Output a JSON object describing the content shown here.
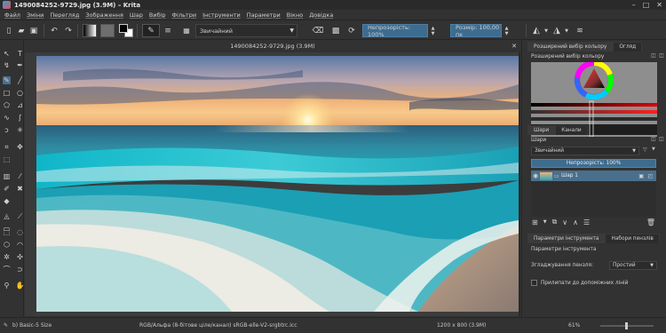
{
  "window": {
    "title": "1490084252-9729.jpg (3.9M) – Krita"
  },
  "menu": [
    "Файл",
    "Зміни",
    "Перегляд",
    "Зображення",
    "Шар",
    "Вибір",
    "Фільтри",
    "Інструменти",
    "Параметри",
    "Вікно",
    "Довідка"
  ],
  "toolbar": {
    "blend_mode": "Звичайний",
    "opacity_label": "Непрозорість: 100%",
    "opacity_value": 1.0,
    "size_label": "Розмір: 100,00 пк"
  },
  "document": {
    "tab_title": "1490084252-9729.jpg (3.9M)"
  },
  "docker": {
    "color_tabs": [
      "Розширений вибір кольору",
      "Огляд"
    ],
    "color_header": "Розширений вибір кольору",
    "layer_tabs": [
      "Шари",
      "Канали"
    ],
    "layers_header": "Шари",
    "layer_blend": "Звичайний",
    "layer_opacity": "Непрозорість: 100%",
    "layer_name": "Шар 1",
    "tool_tabs": [
      "Параметри інструмента",
      "Набори пензлів"
    ],
    "tool_header": "Параметри інструмента",
    "smoothing_label": "Згладжування пензля:",
    "smoothing_value": "Простий",
    "snap_label": "Прилипати до допоміжних ліній"
  },
  "status": {
    "brush": "b) Basic-5 Size",
    "color_info": "RGB/Альфа (8-бітове ціле/канал)  sRGB-elle-V2-srgbtrc.icc",
    "dims": "1200 x 800 (3.9M)",
    "zoom": "61%"
  },
  "colors": {
    "accent": "#3e6c8f",
    "panel": "#323232"
  }
}
